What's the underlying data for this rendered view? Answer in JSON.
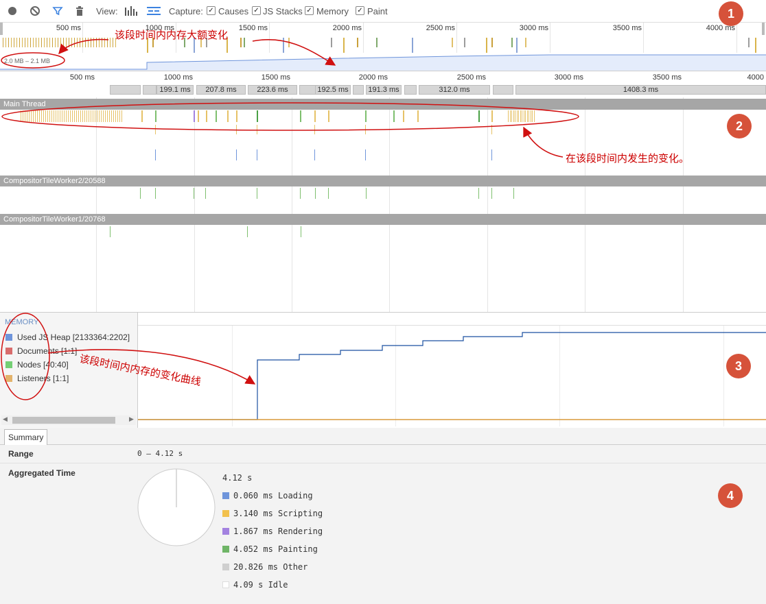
{
  "toolbar": {
    "view_label": "View:",
    "capture_label": "Capture:",
    "options": [
      {
        "label": "Causes",
        "checked": true
      },
      {
        "label": "JS Stacks",
        "checked": true
      },
      {
        "label": "Memory",
        "checked": true
      },
      {
        "label": "Paint",
        "checked": true
      }
    ]
  },
  "overview": {
    "ticks": [
      "500 ms",
      "1000 ms",
      "1500 ms",
      "2000 ms",
      "2500 ms",
      "3000 ms",
      "3500 ms",
      "4000 ms"
    ],
    "memory_range": "2.0 MB – 2.1 MB"
  },
  "timeline": {
    "ticks": [
      "500 ms",
      "1000 ms",
      "1500 ms",
      "2000 ms",
      "2500 ms",
      "3000 ms",
      "3500 ms",
      "4000"
    ],
    "frames": [
      "199.1 ms",
      "207.8 ms",
      "223.6 ms",
      "192.5 ms",
      "191.3 ms",
      "312.0 ms",
      "1408.3 ms"
    ]
  },
  "threads": {
    "main": "Main Thread",
    "worker2": "CompositorTileWorker2/20588",
    "worker1": "CompositorTileWorker1/20768"
  },
  "memory": {
    "title": "MEMORY",
    "legend": [
      {
        "label": "Used JS Heap [2133364:2202]",
        "color": "#6f95db"
      },
      {
        "label": "Documents [1:1]",
        "color": "#d86c6c"
      },
      {
        "label": "Nodes [40:40]",
        "color": "#74cf74"
      },
      {
        "label": "Listeners [1:1]",
        "color": "#e3b36b"
      }
    ]
  },
  "summary": {
    "tab": "Summary",
    "range_label": "Range",
    "range_value": "0 – 4.12 s",
    "aggregated_label": "Aggregated Time",
    "total": "4.12 s",
    "items": [
      {
        "label": "0.060 ms Loading",
        "color": "#6f95db"
      },
      {
        "label": "3.140 ms Scripting",
        "color": "#f2c14d"
      },
      {
        "label": "1.867 ms Rendering",
        "color": "#a382e0"
      },
      {
        "label": "4.052 ms Painting",
        "color": "#6fb567"
      },
      {
        "label": "20.826 ms Other",
        "color": "#cfcfcf"
      },
      {
        "label": "4.09 s Idle",
        "color": "#ffffff"
      }
    ]
  },
  "annotations": {
    "top": "该段时间内内存大额变化",
    "right": "在该段时间内发生的变化。",
    "memory": "该段时间内内存的变化曲线",
    "badges": [
      "1",
      "2",
      "3",
      "4"
    ]
  },
  "colors": {
    "annotation": "#cc0000",
    "badge": "#d6523a",
    "heap_line": "#1a4fa0",
    "listener_line": "#d89a3a"
  }
}
